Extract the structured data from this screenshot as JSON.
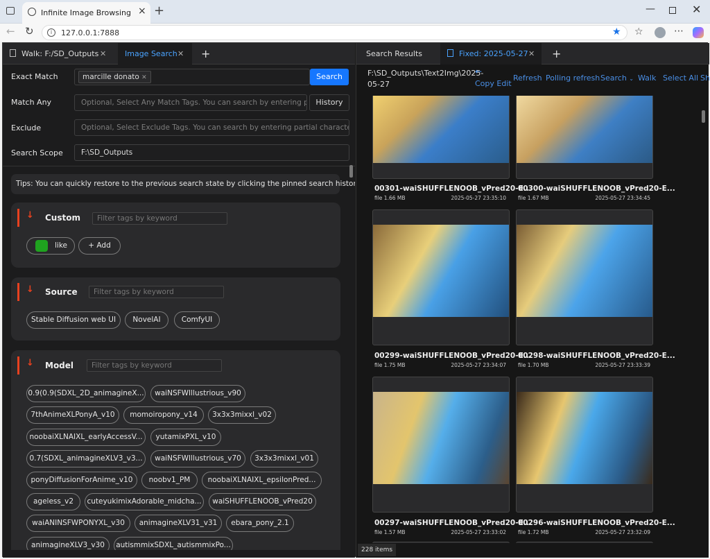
{
  "browser": {
    "tab_title": "Infinite Image Browsing",
    "url": "127.0.0.1:7888"
  },
  "left_panel": {
    "tabs": [
      {
        "label": "Walk: F:/SD_Outputs"
      },
      {
        "label": "Image Search"
      }
    ],
    "search": {
      "exact_match_label": "Exact Match",
      "exact_match_tag": "marcille donato",
      "search_button": "Search",
      "match_any_label": "Match Any",
      "match_any_placeholder": "Optional, Select Any Match Tags. You can search by entering parti...",
      "history_button": "History",
      "exclude_label": "Exclude",
      "exclude_placeholder": "Optional, Select Exclude Tags. You can search by entering partial characters",
      "scope_label": "Search Scope",
      "scope_value": "F:\\SD_Outputs"
    },
    "tips": "Tips: You can quickly restore to the previous search state by clicking the pinned search history.",
    "custom": {
      "title": "Custom",
      "filter_placeholder": "Filter tags by keyword",
      "tags": [
        "like"
      ],
      "add_label": "+ Add",
      "like_color": "#1fa31f"
    },
    "source": {
      "title": "Source",
      "filter_placeholder": "Filter tags by keyword",
      "tags": [
        "Stable Diffusion web UI",
        "NovelAI",
        "ComfyUI"
      ]
    },
    "model": {
      "title": "Model",
      "filter_placeholder": "Filter tags by keyword",
      "tags": [
        "0.9(0.9(SDXL_2D_animagineX...",
        "waiNSFWIllustrious_v90",
        "7thAnimeXLPonyA_v10",
        "momoiropony_v14",
        "3x3x3mixxl_v02",
        "noobaiXLNAIXL_earlyAccessV...",
        "yutamixPXL_v10",
        "0.7(SDXL_animagineXLV3_v3...",
        "waiNSFWIllustrious_v70",
        "3x3x3mixxl_v01",
        "ponyDiffusionForAnime_v10",
        "noobv1_PM",
        "noobaiXLNAIXL_epsilonPred...",
        "ageless_v2",
        "cuteyukimixAdorable_midcha...",
        "waiSHUFFLENOOB_vPred20",
        "waiANINSFWPONYXL_v30",
        "animagineXLV31_v31",
        "ebara_pony_2.1",
        "animagineXLV3_v30",
        "autismmixSDXL_autismmixPo..."
      ]
    }
  },
  "right_panel": {
    "tabs": [
      {
        "label": "Search Results"
      },
      {
        "label": "Fixed: 2025-05-27"
      }
    ],
    "path": "F:\\SD_Outputs\\Text2Img\\2025-05-27",
    "toolbar": {
      "copy_edit": "Copy Edit",
      "refresh": "Refresh",
      "polling_refresh": "Polling refresh",
      "search": "Search",
      "walk": "Walk",
      "select_all": "Select All",
      "share": "Sha"
    },
    "images": [
      {
        "name": "00301-waiSHUFFLENOOB_vPred20-E...",
        "size": "file 1.66 MB",
        "time": "2025-05-27 23:35:10"
      },
      {
        "name": "00300-waiSHUFFLENOOB_vPred20-E...",
        "size": "file 1.67 MB",
        "time": "2025-05-27 23:34:45"
      },
      {
        "name": "00299-waiSHUFFLENOOB_vPred20-E...",
        "size": "file 1.75 MB",
        "time": "2025-05-27 23:34:07"
      },
      {
        "name": "00298-waiSHUFFLENOOB_vPred20-E...",
        "size": "file 1.70 MB",
        "time": "2025-05-27 23:33:39"
      },
      {
        "name": "00297-waiSHUFFLENOOB_vPred20-E...",
        "size": "file 1.57 MB",
        "time": "2025-05-27 23:33:02"
      },
      {
        "name": "00296-waiSHUFFLENOOB_vPred20-E...",
        "size": "file 1.72 MB",
        "time": "2025-05-27 23:32:09"
      }
    ],
    "count": "228 items"
  }
}
